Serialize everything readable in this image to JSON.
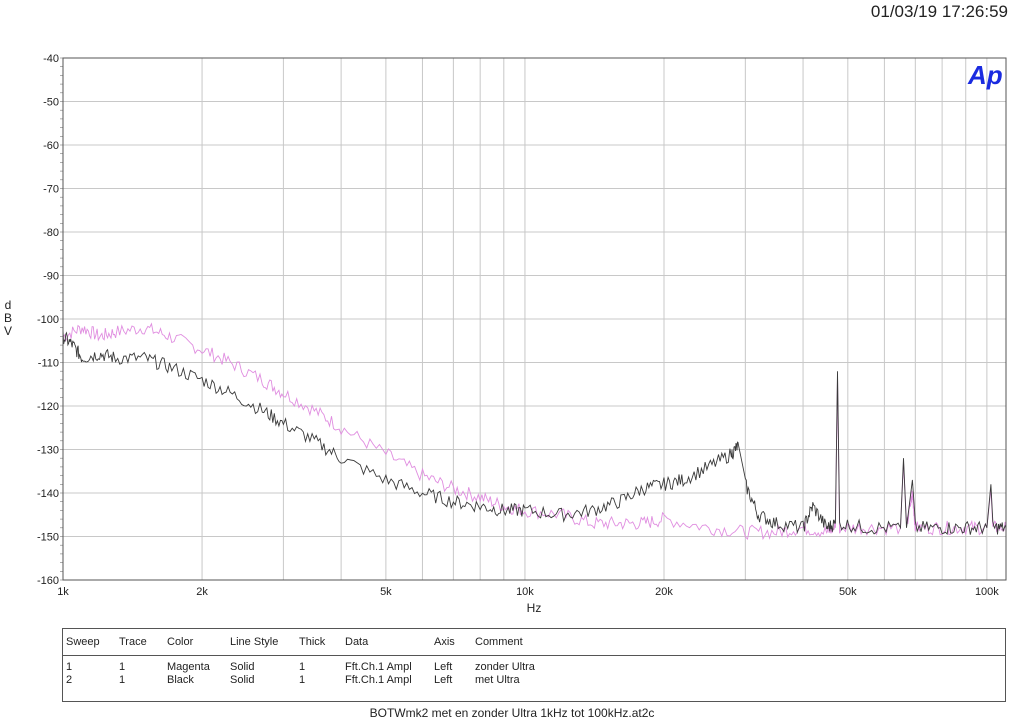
{
  "timestamp": "01/03/19 17:26:59",
  "logo": "Ap",
  "footer": "BOTWmk2 met en zonder Ultra 1kHz tot 100kHz.at2c",
  "legend": {
    "headers": [
      "Sweep",
      "Trace",
      "Color",
      "Line Style",
      "Thick",
      "Data",
      "Axis",
      "Comment"
    ],
    "rows": [
      [
        "1",
        "1",
        "Magenta",
        "Solid",
        "1",
        "Fft.Ch.1 Ampl",
        "Left",
        "zonder Ultra"
      ],
      [
        "2",
        "1",
        "Black",
        "Solid",
        "1",
        "Fft.Ch.1 Ampl",
        "Left",
        "met Ultra"
      ]
    ]
  },
  "colors": {
    "magenta": "#e08ee0",
    "black": "#3a3a3a",
    "grid": "#c8c8c8",
    "logo": "#1a2be0"
  },
  "chart_data": {
    "type": "line",
    "xlabel": "Hz",
    "ylabel": "dBV",
    "xscale": "log",
    "xlim": [
      1000,
      110000
    ],
    "ylim": [
      -160,
      -40
    ],
    "grid": true,
    "x_ticks": [
      {
        "v": 1000,
        "label": "1k"
      },
      {
        "v": 2000,
        "label": "2k"
      },
      {
        "v": 5000,
        "label": "5k"
      },
      {
        "v": 10000,
        "label": "10k"
      },
      {
        "v": 20000,
        "label": "20k"
      },
      {
        "v": 50000,
        "label": "50k"
      },
      {
        "v": 100000,
        "label": "100k"
      }
    ],
    "y_ticks": [
      -40,
      -50,
      -60,
      -70,
      -80,
      -90,
      -100,
      -110,
      -120,
      -130,
      -140,
      -150,
      -160
    ],
    "series": [
      {
        "name": "zonder Ultra",
        "color": "magenta",
        "x": [
          1000,
          1100,
          1200,
          1300,
          1500,
          1700,
          2000,
          2300,
          2700,
          3000,
          3500,
          4000,
          5000,
          6000,
          7000,
          8000,
          9000,
          10000,
          12000,
          14000,
          16000,
          18000,
          20000,
          25000,
          30000,
          35000,
          40000,
          45000,
          47000,
          47500,
          48000,
          55000,
          65000,
          66000,
          67000,
          69000,
          70000,
          80000,
          90000,
          100000,
          102000,
          103000,
          110000
        ],
        "y": [
          -104,
          -102,
          -104,
          -103,
          -102,
          -104,
          -107,
          -110,
          -114,
          -117,
          -121,
          -125,
          -131,
          -136,
          -139,
          -141,
          -143,
          -144,
          -145,
          -147,
          -147,
          -147,
          -146,
          -148,
          -149,
          -149,
          -148,
          -149,
          -148,
          -113,
          -148,
          -148,
          -148,
          -133,
          -148,
          -140,
          -148,
          -148,
          -148,
          -148,
          -139,
          -148,
          -148
        ]
      },
      {
        "name": "met Ultra",
        "color": "black",
        "x": [
          1000,
          1050,
          1100,
          1200,
          1300,
          1500,
          1700,
          2000,
          2300,
          2700,
          3000,
          3500,
          4000,
          5000,
          6000,
          7000,
          8000,
          9000,
          10000,
          12000,
          14000,
          16000,
          18000,
          20000,
          22000,
          25000,
          28000,
          29000,
          30000,
          32000,
          35000,
          40000,
          42000,
          45000,
          47000,
          47500,
          48000,
          55000,
          65000,
          66000,
          67000,
          69000,
          70000,
          80000,
          90000,
          100000,
          102000,
          103000,
          110000
        ],
        "y": [
          -104,
          -106,
          -109,
          -108,
          -109,
          -109,
          -111,
          -114,
          -117,
          -121,
          -124,
          -128,
          -132,
          -137,
          -140,
          -142,
          -143,
          -144,
          -144,
          -145,
          -144,
          -142,
          -139,
          -138,
          -137,
          -134,
          -131,
          -129,
          -138,
          -145,
          -147,
          -148,
          -143,
          -148,
          -147,
          -112,
          -147,
          -148,
          -148,
          -132,
          -148,
          -137,
          -148,
          -148,
          -148,
          -148,
          -138,
          -148,
          -148
        ]
      }
    ]
  }
}
